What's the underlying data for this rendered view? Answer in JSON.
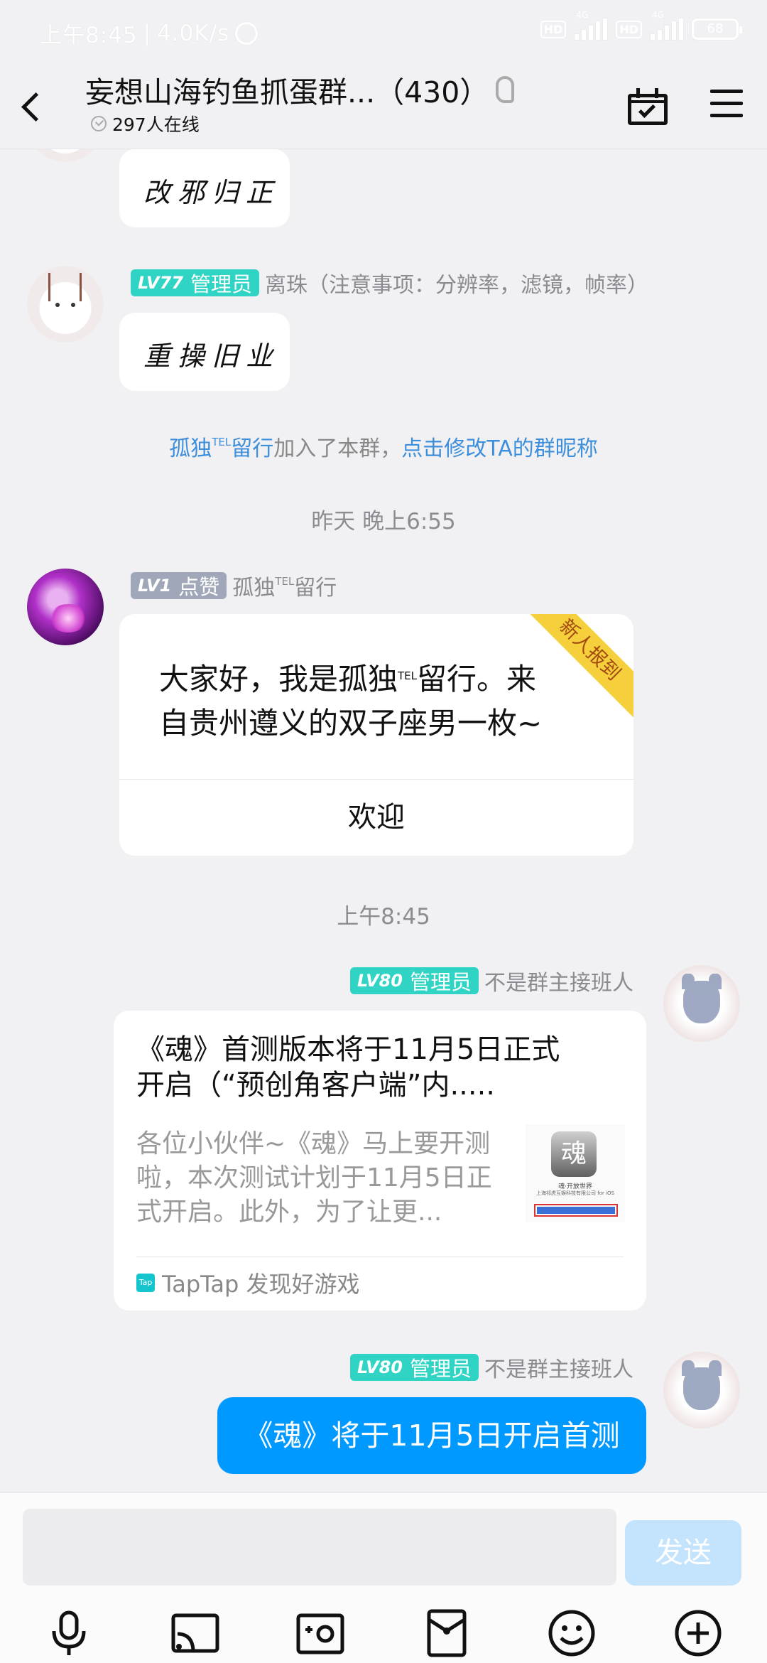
{
  "status_bar": {
    "time": "上午8:45",
    "speed": "4.0K/s",
    "net1": "4G",
    "net2": "4G",
    "hd": "HD",
    "battery": "68"
  },
  "header": {
    "title": "妄想山海钓鱼抓蛋群...（430）",
    "online": "297人在线"
  },
  "messages": {
    "m1": {
      "text": "改邪归正"
    },
    "m2": {
      "level": "LV77",
      "role": "管理员",
      "sender": "离珠（注意事项：分辨率，滤镜，帧率）",
      "text": "重操旧业"
    },
    "sys1": {
      "name": "孤独",
      "name_sup": "TEL",
      "name_end": "留行",
      "middle": "加入了本群，",
      "action": "点击修改TA的群昵称"
    },
    "time1": "昨天 晚上6:55",
    "m3": {
      "level": "LV1",
      "role": "点赞",
      "sender": "孤独",
      "sender_sup": "TEL",
      "sender_end": "留行",
      "ribbon": "新人报到",
      "text_a": "大家好，我是孤独",
      "text_sup": "TEL",
      "text_b": "留行。来",
      "text_c": "自贵州遵义的双子座男一枚~",
      "welcome": "欢迎"
    },
    "time2": "上午8:45",
    "m4": {
      "level": "LV80",
      "role": "管理员",
      "sender": "不是群主接班人",
      "card_title_1": "《魂》首测版本将于11月5日正式",
      "card_title_2": "开启（“预创角客户端”内.....",
      "card_desc_1": "各位小伙伴~《魂》马上要开测",
      "card_desc_2": "啦，本次测试计划于11月5日正",
      "card_desc_3": "式开启。此外，为了让更...",
      "thumb_caption_1": "魂·开放世界",
      "thumb_caption_2": "上海祁虎互娱科技有限公司 for iOS",
      "thumb_glyph": "魂",
      "source_icon": "Tap",
      "source": "TapTap 发现好游戏"
    },
    "m5": {
      "level": "LV80",
      "role": "管理员",
      "sender": "不是群主接班人",
      "text": "《魂》将于11月5日开启首测"
    }
  },
  "input": {
    "placeholder": "",
    "send_label": "发送"
  },
  "colors": {
    "accent": "#0099ff",
    "admin_badge": "#2fd4c4",
    "link": "#3d8fdc",
    "ribbon": "#f5d03c"
  }
}
